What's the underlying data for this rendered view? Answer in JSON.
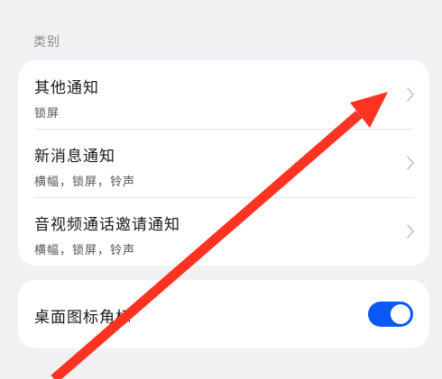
{
  "section": {
    "label": "类别"
  },
  "items": [
    {
      "title": "其他通知",
      "subtitle": "锁屏",
      "icon": "chevron-right-icon"
    },
    {
      "title": "新消息通知",
      "subtitle": "横幅，锁屏，铃声",
      "icon": "chevron-right-icon"
    },
    {
      "title": "音视频通话邀请通知",
      "subtitle": "横幅，锁屏，铃声",
      "icon": "chevron-right-icon"
    }
  ],
  "badge_setting": {
    "label": "桌面图标角标",
    "enabled": true
  },
  "colors": {
    "background": "#f1f1f3",
    "card": "#ffffff",
    "toggle_on": "#0a59f7",
    "annotation_arrow": "#ff3322"
  }
}
